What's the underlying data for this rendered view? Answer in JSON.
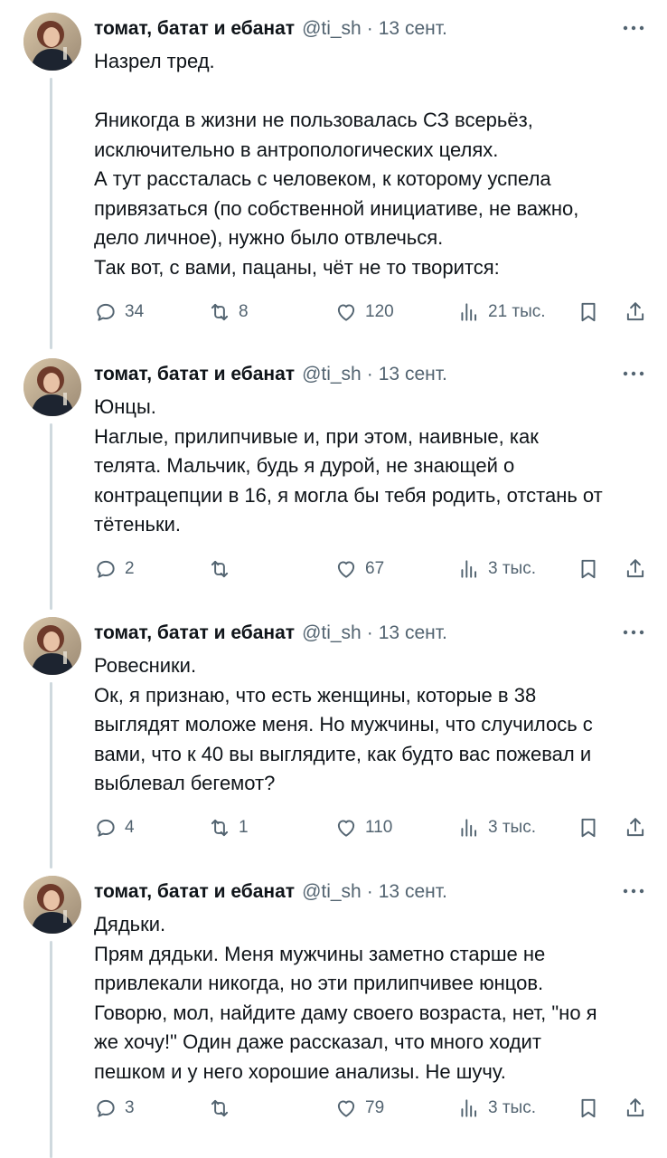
{
  "tweets": [
    {
      "name": "томат, батат и ебанат",
      "handle": "@ti_sh",
      "sep": "·",
      "date": "13 сент.",
      "text": "Назрел тред.\n\nЯникогда в жизни не пользовалась СЗ всерьёз,\nисключительно в антропологических целях.\nА тут рассталась с человеком, к которому успела\nпривязаться (по собственной инициативе, не важно,\nдело личное), нужно было отвлечься.\nТак вот, с вами, пацаны, чёт не то творится:",
      "replies": "34",
      "retweets": "8",
      "likes": "120",
      "views": "21 тыс."
    },
    {
      "name": "томат, батат и ебанат",
      "handle": "@ti_sh",
      "sep": "·",
      "date": "13 сент.",
      "text": "Юнцы.\nНаглые, прилипчивые и, при этом, наивные, как\nтелята. Мальчик, будь я дурой, не знающей о\nконтрацепции в 16, я могла бы тебя родить, отстань от\nтётеньки.",
      "replies": "2",
      "retweets": "",
      "likes": "67",
      "views": "3 тыс."
    },
    {
      "name": "томат, батат и ебанат",
      "handle": "@ti_sh",
      "sep": "·",
      "date": "13 сент.",
      "text": "Ровесники.\nОк, я признаю, что есть женщины, которые в 38\nвыглядят моложе меня. Но мужчины, что случилось с\nвами, что к 40 вы выглядите, как будто вас пожевал и\nвыблевал бегемот?",
      "replies": "4",
      "retweets": "1",
      "likes": "110",
      "views": "3 тыс."
    },
    {
      "name": "томат, батат и ебанат",
      "handle": "@ti_sh",
      "sep": "·",
      "date": "13 сент.",
      "text": "Дядьки.\nПрям дядьки. Меня мужчины заметно старше не\nпривлекали никогда, но эти прилипчивее юнцов.\nГоворю, мол, найдите даму своего возраста, нет, \"но я\nже хочу!\" Один даже рассказал, что много ходит\nпешком и у него хорошие анализы. Не шучу.",
      "replies": "3",
      "retweets": "",
      "likes": "79",
      "views": "3 тыс."
    }
  ],
  "icons": {
    "reply": "reply-icon",
    "retweet": "retweet-icon",
    "like": "like-icon",
    "views": "views-icon",
    "bookmark": "bookmark-icon",
    "share": "share-icon",
    "more": "more-icon"
  },
  "colors": {
    "text": "#0f1419",
    "secondary": "#536471",
    "thread_line": "#cfd9de"
  }
}
